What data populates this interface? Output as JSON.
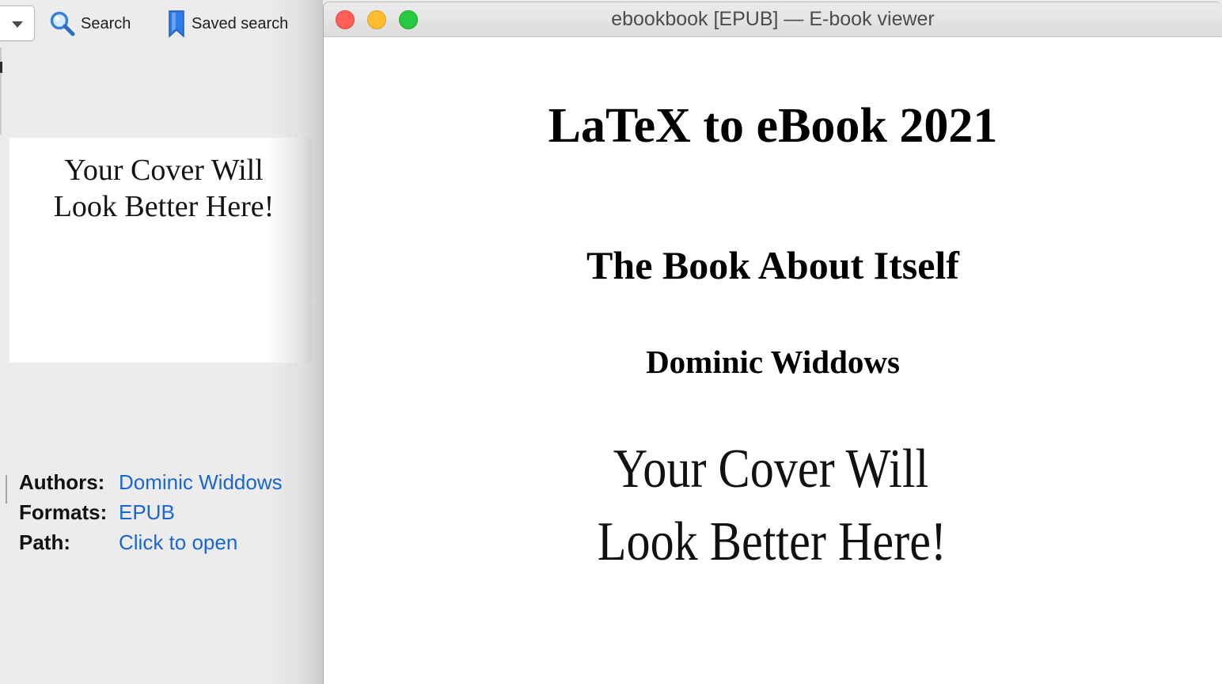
{
  "main_window": {
    "toolbar": {
      "search_label": "Search",
      "saved_search_label": "Saved search"
    },
    "cover_placeholder": {
      "line1": "Your Cover Will",
      "line2": "Look Better Here!"
    },
    "details": [
      {
        "key": "Authors:",
        "value": "Dominic Widdows"
      },
      {
        "key": "Formats:",
        "value": "EPUB"
      },
      {
        "key": "Path:",
        "value": "Click to open"
      }
    ]
  },
  "viewer": {
    "window_title": "ebookbook [EPUB] — E-book viewer",
    "page": {
      "title": "LaTeX to eBook 2021",
      "subtitle": "The Book About Itself",
      "author": "Dominic Widdows",
      "cover_image": {
        "line1": "Your Cover Will",
        "line2": "Look Better Here!"
      }
    }
  },
  "colors": {
    "link": "#1a66d2",
    "close": "#fe5f57",
    "minimize": "#febc2e",
    "maximize": "#28c840",
    "search_icon": "#3b82d6",
    "bookmark_icon": "#2f7be5"
  },
  "icons": {
    "search": "magnifier-icon",
    "saved_search": "bookmark-icon",
    "dropdown": "chevron-down-icon"
  }
}
